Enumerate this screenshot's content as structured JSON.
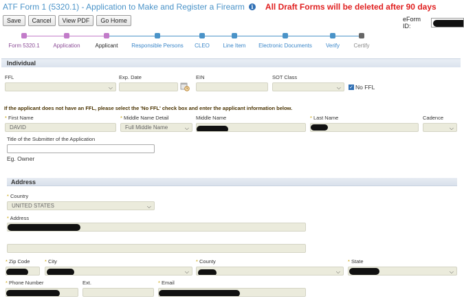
{
  "header": {
    "title": "ATF Form 1 (5320.1) - Application to Make and Register a Firearm",
    "info_icon": "i",
    "warning": "All Draft Forms will be deleted after 90 days"
  },
  "toolbar": {
    "save_label": "Save",
    "cancel_label": "Cancel",
    "view_pdf_label": "View PDF",
    "go_home_label": "Go Home"
  },
  "eform": {
    "label": "eForm ID:"
  },
  "steps": [
    {
      "label": "Form 5320.1",
      "state": "done"
    },
    {
      "label": "Application",
      "state": "done"
    },
    {
      "label": "Applicant",
      "state": "current"
    },
    {
      "label": "Responsible Persons",
      "state": "todo"
    },
    {
      "label": "CLEO",
      "state": "todo"
    },
    {
      "label": "Line Item",
      "state": "todo"
    },
    {
      "label": "Electronic Documents",
      "state": "todo"
    },
    {
      "label": "Verify",
      "state": "todo"
    },
    {
      "label": "Certify",
      "state": "locked"
    }
  ],
  "colors": {
    "title": "#4a93c8",
    "warning": "#e02020",
    "done": "#c27bc9",
    "todo": "#4a93c8",
    "locked": "#666666",
    "field_bg": "#ebebdc",
    "required_star": "#c8a000"
  },
  "individual": {
    "section_title": "Individual",
    "ffl_label": "FFL",
    "exp_date_label": "Exp. Date",
    "ein_label": "EIN",
    "sot_class_label": "SOT Class",
    "no_ffl_label": "No FFL",
    "no_ffl_checked": true,
    "notice": "If the applicant does not have an FFL, please select the 'No FFL' check box and enter the applicant information below.",
    "first_name_label": "* First Name",
    "first_name_value": "DAVID",
    "middle_detail_label": "* Middle Name Detail",
    "middle_detail_value": "Full Middle Name",
    "middle_name_label": "Middle Name",
    "last_name_label": "* Last Name",
    "cadence_label": "Cadence",
    "submitter_title_label": "Title of the Submitter of the Application",
    "example_text": "Eg. Owner"
  },
  "address": {
    "section_title": "Address",
    "country_label": "* Country",
    "country_value": "UNITED STATES",
    "address_label": "* Address",
    "zip_label": "* Zip Code",
    "city_label": "* City",
    "county_label": "* County",
    "state_label": "* State",
    "phone_label": "* Phone Number",
    "ext_label": "Ext.",
    "email_label": "* Email"
  },
  "icons": {
    "dropdown": "chevron-down-icon",
    "calendar": "calendar-clock-icon",
    "info": "info-icon",
    "checkbox": "checkmark-icon"
  }
}
